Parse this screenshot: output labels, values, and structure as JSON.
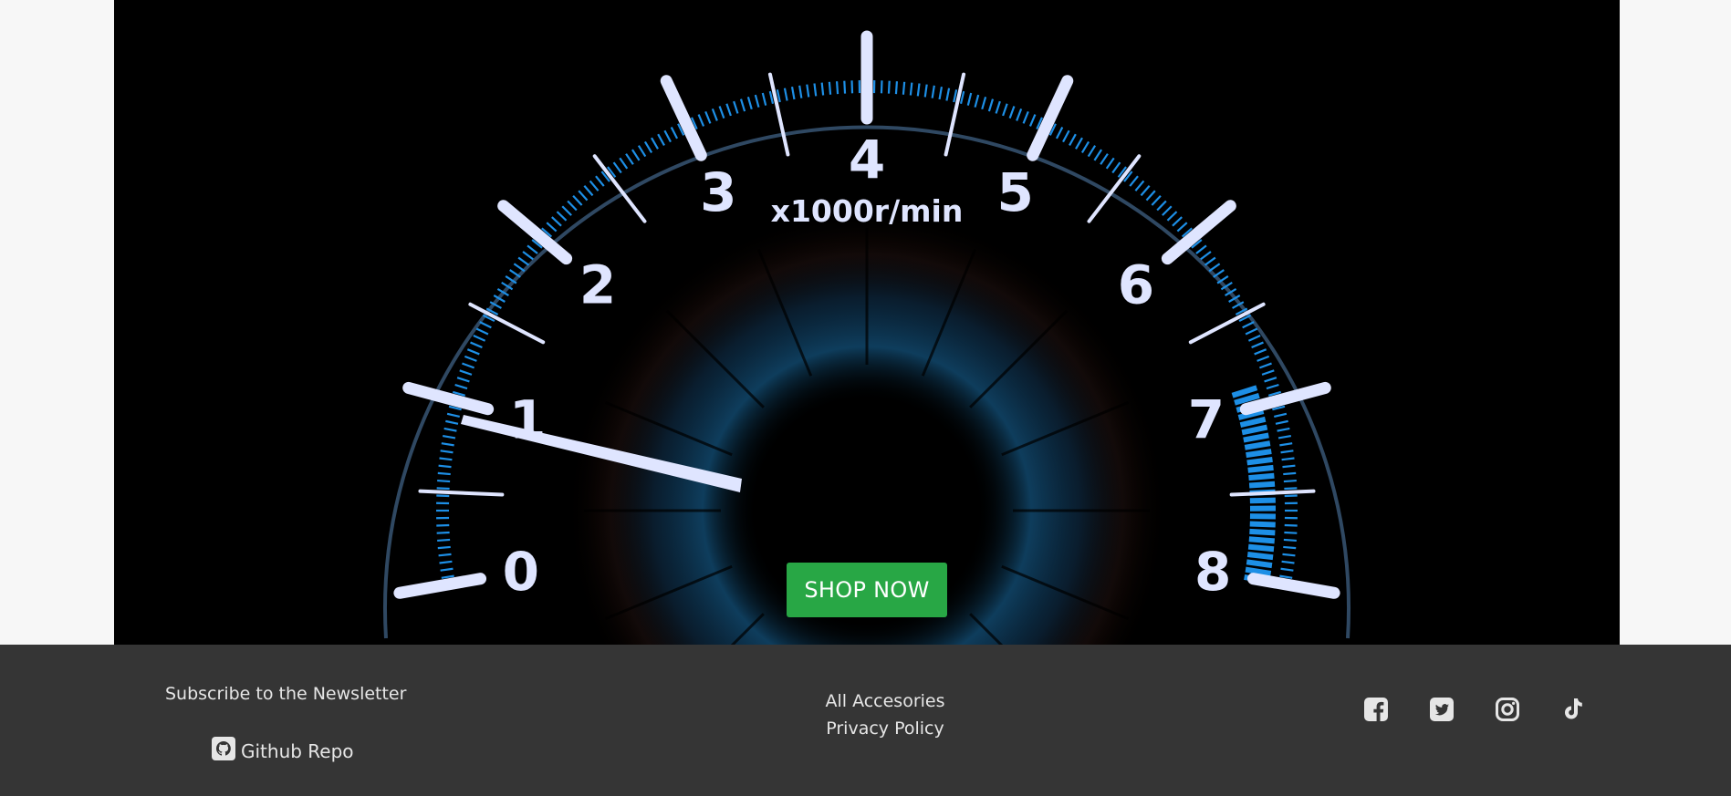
{
  "hero": {
    "gauge_unit_label": "x1000r/min",
    "dial_numbers": [
      "0",
      "1",
      "2",
      "3",
      "4",
      "5",
      "6",
      "7",
      "8"
    ],
    "cta_label": "SHOP NOW"
  },
  "footer": {
    "newsletter_label": "Subscribe to the Newsletter",
    "github_label": "Github Repo",
    "links": [
      "All Accesories",
      "Privacy Policy"
    ],
    "social_icons": [
      "facebook-icon",
      "twitter-icon",
      "instagram-icon",
      "tiktok-icon"
    ]
  },
  "colors": {
    "cta_background": "#28a745",
    "footer_background": "#353535",
    "hero_background": "#000000",
    "gauge_accent": "#1d8fe6",
    "gauge_marks": "#dfe5ff"
  }
}
